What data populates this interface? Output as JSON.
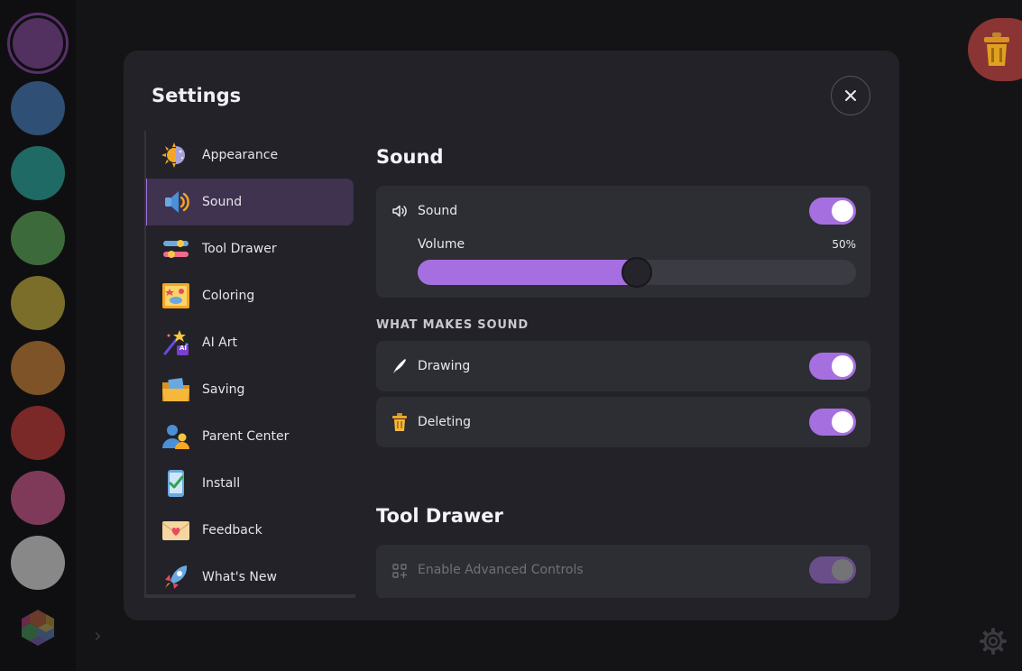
{
  "modal": {
    "title": "Settings"
  },
  "nav": {
    "items": [
      {
        "label": "Appearance",
        "icon": "sun-moon-icon"
      },
      {
        "label": "Sound",
        "icon": "speaker-icon",
        "active": true
      },
      {
        "label": "Tool Drawer",
        "icon": "sliders-icon"
      },
      {
        "label": "Coloring",
        "icon": "coloring-book-icon"
      },
      {
        "label": "AI Art",
        "icon": "magic-wand-icon"
      },
      {
        "label": "Saving",
        "icon": "folder-icon"
      },
      {
        "label": "Parent Center",
        "icon": "parents-icon"
      },
      {
        "label": "Install",
        "icon": "phone-check-icon"
      },
      {
        "label": "Feedback",
        "icon": "heart-envelope-icon"
      },
      {
        "label": "What's New",
        "icon": "rocket-icon"
      }
    ],
    "ai_badge": "AI"
  },
  "sound_section": {
    "title": "Sound",
    "sound_label": "Sound",
    "sound_on": true,
    "volume_label": "Volume",
    "volume_value": "50%",
    "volume_fraction": 0.5
  },
  "what_makes_sound": {
    "heading": "WHAT MAKES SOUND",
    "drawing_label": "Drawing",
    "drawing_on": true,
    "deleting_label": "Deleting",
    "deleting_on": true
  },
  "tool_drawer_section": {
    "title": "Tool Drawer",
    "advanced_label": "Enable Advanced Controls",
    "advanced_on": true
  },
  "palette": {
    "colors": [
      "#52305f",
      "#2f4f74",
      "#1f6a64",
      "#3d6a3a",
      "#7a6e2a",
      "#7d5327",
      "#7a2828",
      "#7f3a5a",
      "#888888"
    ]
  },
  "colors": {
    "accent": "#a66fe0",
    "modal_bg": "#222228",
    "card_bg": "#2d2d34",
    "trash": "#8a3434"
  }
}
